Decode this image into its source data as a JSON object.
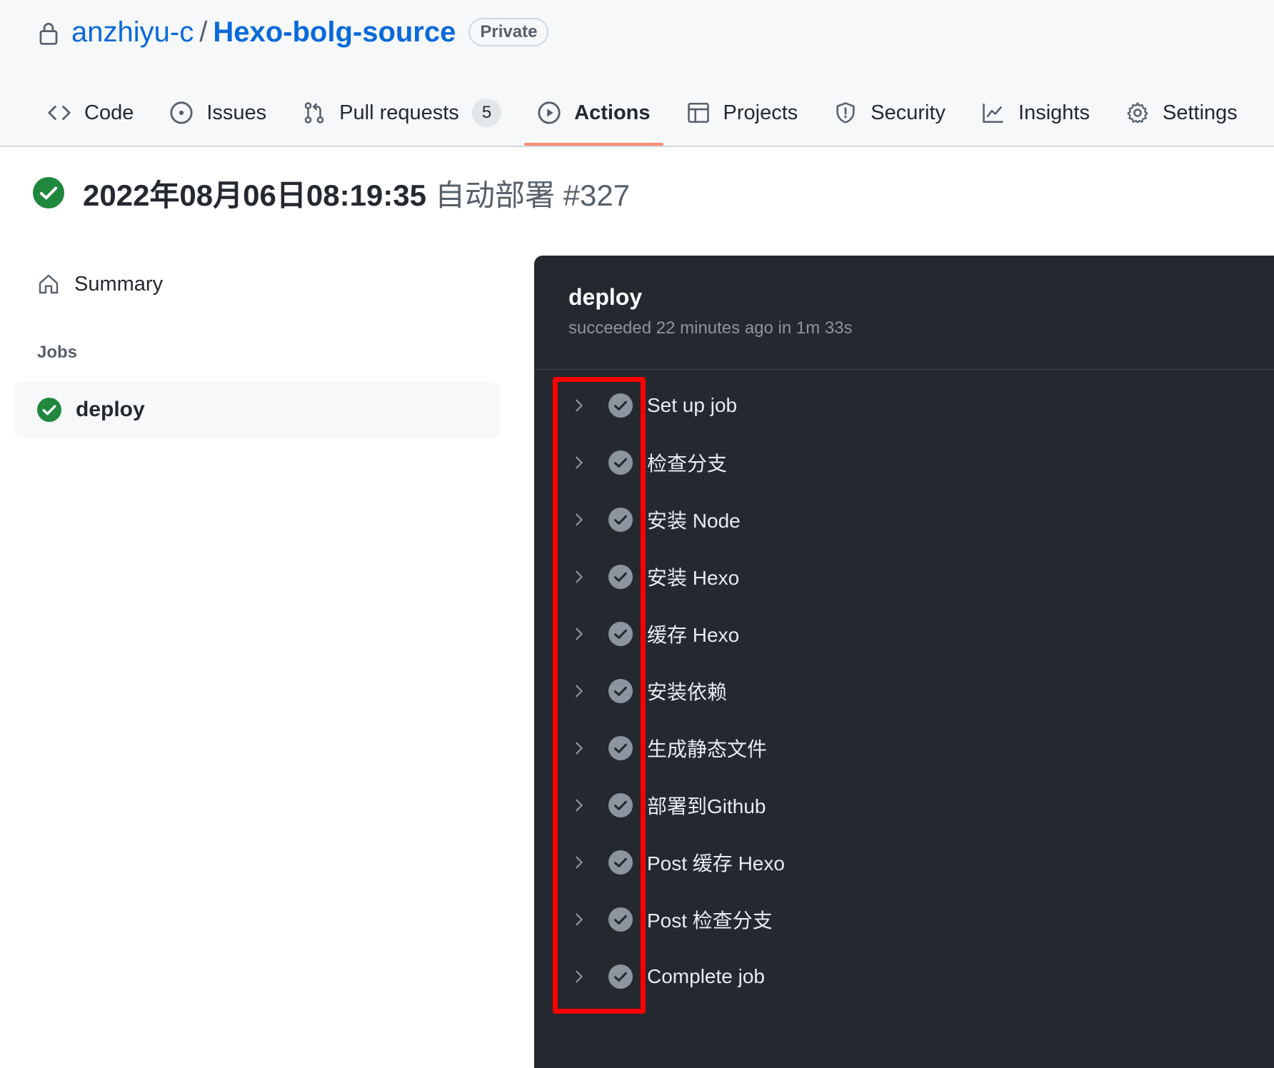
{
  "repo": {
    "owner": "anzhiyu-c",
    "separator": "/",
    "name": "Hexo-bolg-source",
    "visibility": "Private"
  },
  "tabs": [
    {
      "label": "Code",
      "icon": "code-icon"
    },
    {
      "label": "Issues",
      "icon": "issue-icon"
    },
    {
      "label": "Pull requests",
      "icon": "pull-request-icon",
      "count": "5"
    },
    {
      "label": "Actions",
      "icon": "play-icon",
      "active": true
    },
    {
      "label": "Projects",
      "icon": "table-icon"
    },
    {
      "label": "Security",
      "icon": "shield-icon"
    },
    {
      "label": "Insights",
      "icon": "graph-icon"
    },
    {
      "label": "Settings",
      "icon": "gear-icon"
    }
  ],
  "run": {
    "title": "2022年08月06日08:19:35",
    "subtitle": "自动部署 #327",
    "status_color": "#1f883d"
  },
  "sidebar": {
    "summary_label": "Summary",
    "jobs_heading": "Jobs",
    "jobs": [
      {
        "label": "deploy",
        "status": "success"
      }
    ]
  },
  "job_panel": {
    "name": "deploy",
    "status_text": "succeeded 22 minutes ago in 1m 33s",
    "steps": [
      "Set up job",
      "检查分支",
      "安装 Node",
      "安装 Hexo",
      "缓存 Hexo",
      "安装依赖",
      "生成静态文件",
      "部署到Github",
      "Post 缓存 Hexo",
      "Post 检查分支",
      "Complete job"
    ]
  },
  "colors": {
    "accent": "#0969da",
    "active_tab_underline": "#fd8c73",
    "panel_bg": "#24292f",
    "annotation": "#ff0000"
  }
}
